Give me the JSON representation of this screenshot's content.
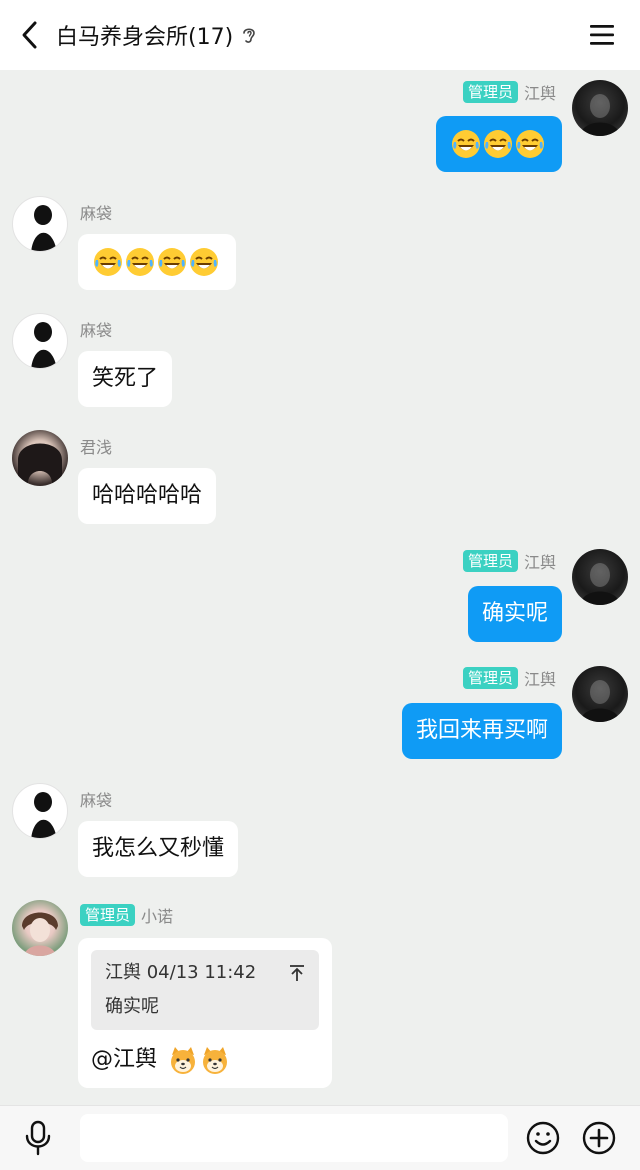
{
  "header": {
    "title": "白马养身会所(17)",
    "icons": {
      "back": "chevron-left-icon",
      "ear": "ear-icon",
      "menu": "hamburger-menu-icon"
    }
  },
  "colors": {
    "accent_bubble": "#0f9bf5",
    "badge": "#3bd1c2",
    "background": "#eef0ee"
  },
  "messages": [
    {
      "direction": "out",
      "sender": "江舆",
      "badge": "管理员",
      "emoji_count": 3,
      "emoji": "tears-of-joy"
    },
    {
      "direction": "in",
      "sender": "麻袋",
      "emoji_count": 4,
      "emoji": "tears-of-joy"
    },
    {
      "direction": "in",
      "sender": "麻袋",
      "text": "笑死了"
    },
    {
      "direction": "in",
      "sender": "君浅",
      "text": "哈哈哈哈哈"
    },
    {
      "direction": "out",
      "sender": "江舆",
      "badge": "管理员",
      "text": "确实呢"
    },
    {
      "direction": "out",
      "sender": "江舆",
      "badge": "管理员",
      "text": "我回来再买啊"
    },
    {
      "direction": "in",
      "sender": "麻袋",
      "text": "我怎么又秒懂"
    },
    {
      "direction": "in",
      "sender": "小诺",
      "badge": "管理员",
      "quote": {
        "author_time": "江舆 04/13 11:42",
        "text": "确实呢"
      },
      "text": "@江舆",
      "emoji_count": 2,
      "emoji": "shiba-dog"
    }
  ],
  "footer": {
    "input_value": "",
    "icons": {
      "mic": "microphone-icon",
      "emoji": "smiley-icon",
      "more": "plus-circle-icon"
    }
  }
}
